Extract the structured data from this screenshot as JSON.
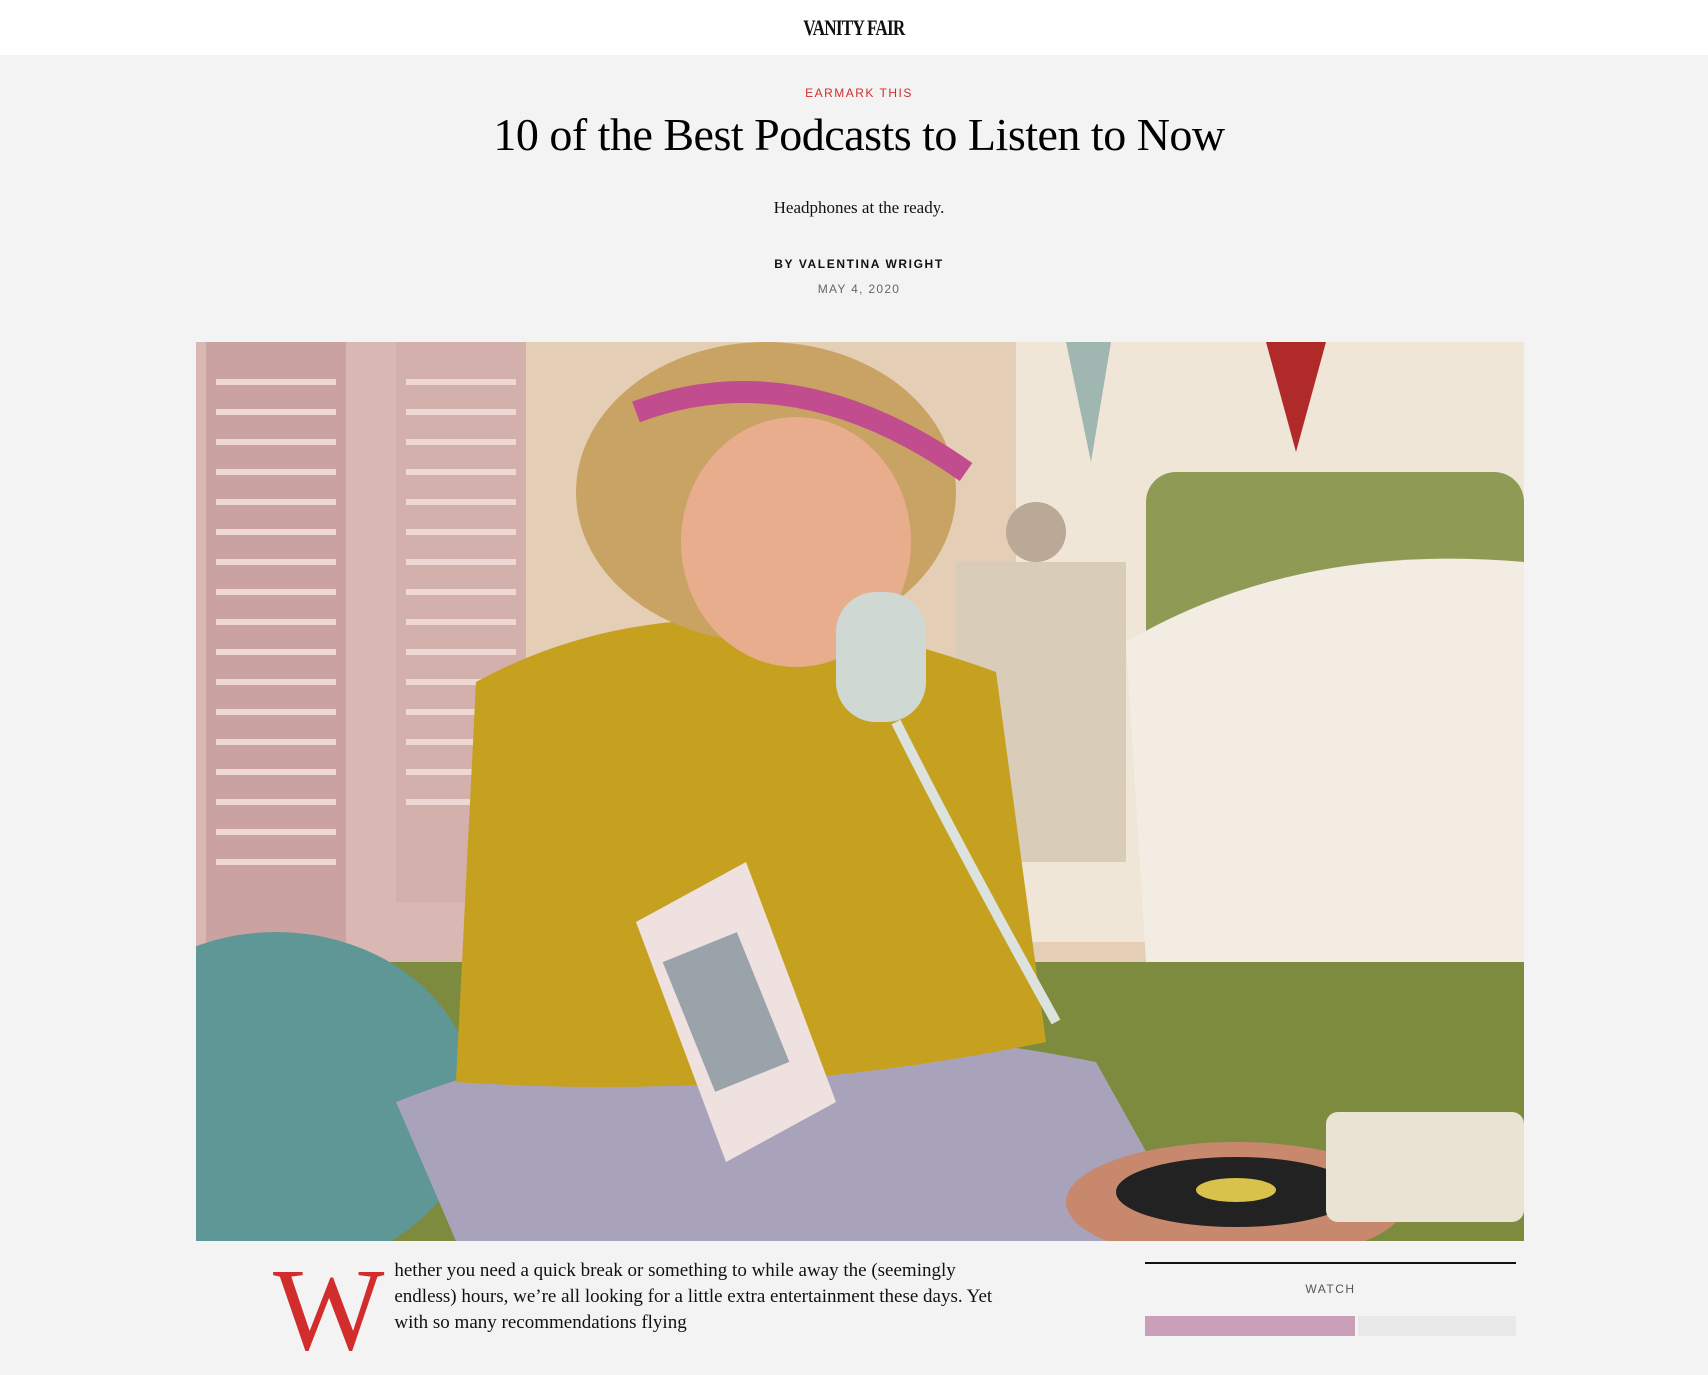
{
  "header": {
    "logo": "VANITY FAIR"
  },
  "article": {
    "rubric": "EARMARK THIS",
    "headline": "10 of the Best Podcasts to Listen to Now",
    "dek": "Headphones at the ready.",
    "byline_prefix": "BY",
    "author": "VALENTINA WRIGHT",
    "date": "MAY 4, 2020",
    "dropcap": "W",
    "body": "hether you need a quick break or something to while away the (seemingly endless) hours, we’re all looking for a little extra entertainment these days. Yet with so many recommendations flying"
  },
  "sidebar": {
    "label": "WATCH"
  },
  "colors": {
    "accent": "#d12d2d",
    "background": "#f3f3f3",
    "header_bg": "#ffffff"
  }
}
